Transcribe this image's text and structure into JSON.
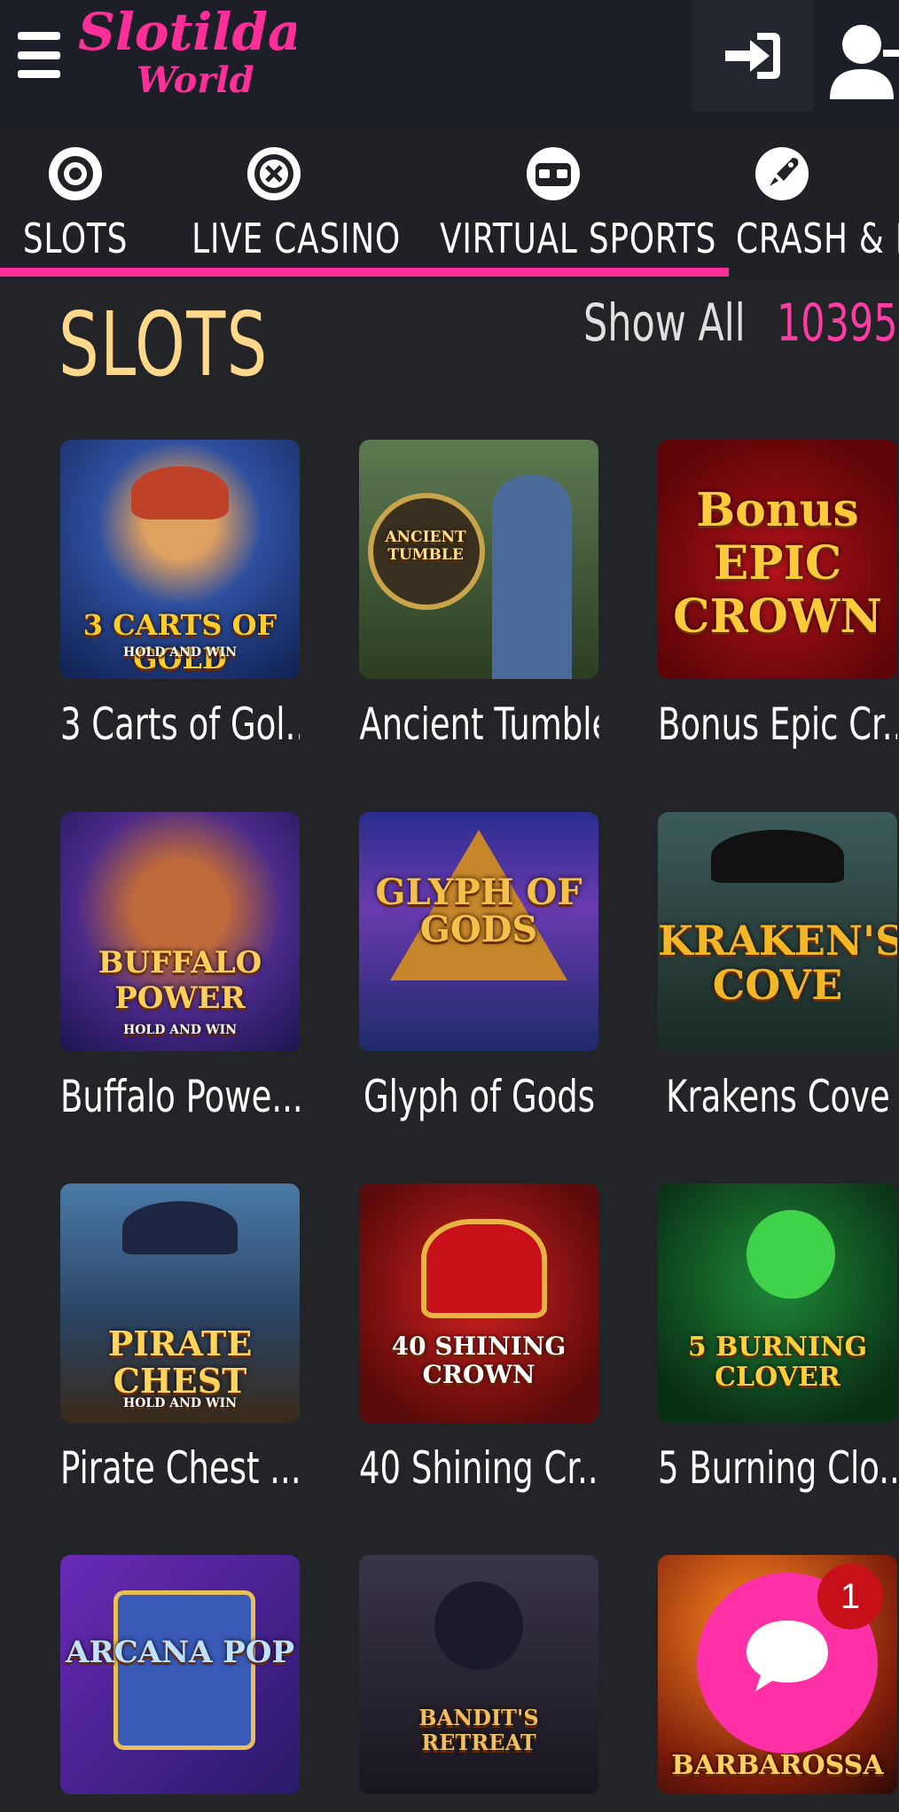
{
  "header": {
    "logo_line1": "Slotilda",
    "logo_line2": "World",
    "menu_icon": "hamburger-icon",
    "login_icon": "sign-in-icon",
    "register_icon": "user-plus-icon"
  },
  "tabs": [
    {
      "label": "SLOTS",
      "icon": "slot-reel-icon"
    },
    {
      "label": "LIVE CASINO",
      "icon": "roulette-chip-icon"
    },
    {
      "label": "VIRTUAL SPORTS",
      "icon": "vr-headset-icon"
    },
    {
      "label": "CRASH & F",
      "icon": "rocket-icon"
    }
  ],
  "section": {
    "title": "SLOTS",
    "show_all_label": "Show All",
    "count": "10395"
  },
  "games": [
    {
      "name": "3 Carts of Gol...",
      "art_title": "3 CARTS OF GOLD",
      "art_sub": "HOLD AND WIN"
    },
    {
      "name": "Ancient Tumble",
      "art_title": "ANCIENT TUMBLE",
      "art_sub": ""
    },
    {
      "name": "Bonus Epic Cr...",
      "art_title": "Bonus EPIC CROWN",
      "art_sub": ""
    },
    {
      "name": "Buffalo Powe...",
      "art_title": "BUFFALO POWER",
      "art_sub": "HOLD AND WIN"
    },
    {
      "name": "Glyph of Gods",
      "art_title": "GLYPH OF GODS",
      "art_sub": ""
    },
    {
      "name": "Krakens Cove",
      "art_title": "KRAKEN'S COVE",
      "art_sub": ""
    },
    {
      "name": "Pirate Chest ...",
      "art_title": "PIRATE CHEST",
      "art_sub": "HOLD AND WIN"
    },
    {
      "name": "40 Shining Cr...",
      "art_title": "40 SHINING CROWN",
      "art_sub": ""
    },
    {
      "name": "5 Burning Clo...",
      "art_title": "5 BURNING CLOVER",
      "art_sub": ""
    },
    {
      "name": "",
      "art_title": "ARCANA POP",
      "art_sub": ""
    },
    {
      "name": "",
      "art_title": "BANDIT'S RETREAT",
      "art_sub": ""
    },
    {
      "name": "",
      "art_title": "BARBAROSSA",
      "art_sub": ""
    }
  ],
  "chat": {
    "badge_count": "1",
    "icon": "chat-bubble-icon"
  },
  "colors": {
    "accent_pink": "#ff2f9a",
    "section_gold": "#ffd88c",
    "badge_red": "#c8101a"
  }
}
